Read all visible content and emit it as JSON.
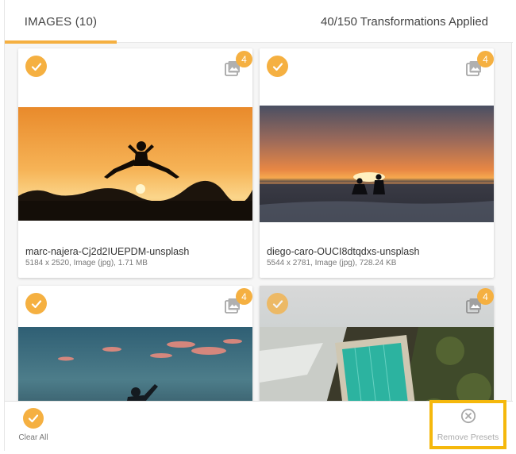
{
  "header": {
    "tab_label": "IMAGES (10)",
    "transformations": "40/150 Transformations Applied"
  },
  "images": [
    {
      "name": "marc-najera-Cj2d2IUEPDM-unsplash",
      "meta": "5184 x 2520, Image (jpg), 1.71 MB",
      "preset_count": "4",
      "selected": true
    },
    {
      "name": "diego-caro-OUCI8dtqdxs-unsplash",
      "meta": "5544 x 2781, Image (jpg), 728.24 KB",
      "preset_count": "4",
      "selected": true
    },
    {
      "preset_count": "4",
      "selected": true
    },
    {
      "preset_count": "4",
      "selected": true
    }
  ],
  "footer": {
    "clear_all_label": "Clear All",
    "remove_presets_label": "Remove Presets"
  },
  "colors": {
    "accent": "#f5b041",
    "highlight_border": "#f5b80c"
  },
  "icons": {
    "select": "check-icon",
    "presets": "image-stack-icon",
    "remove": "close-circle-icon"
  }
}
